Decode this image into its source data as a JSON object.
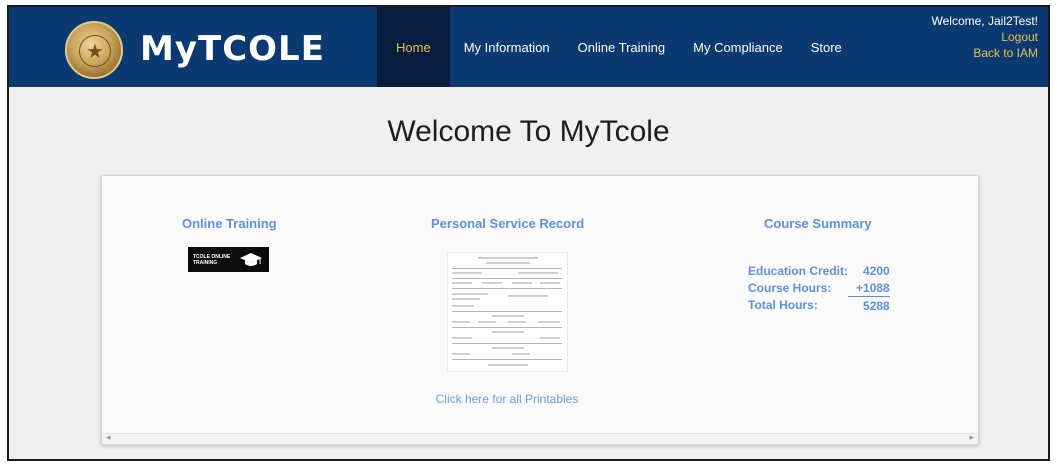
{
  "header": {
    "brand": "MyTCOLE",
    "nav": [
      {
        "label": "Home",
        "active": true
      },
      {
        "label": "My Information"
      },
      {
        "label": "Online Training"
      },
      {
        "label": "My Compliance"
      },
      {
        "label": "Store"
      }
    ],
    "user": {
      "welcome": "Welcome, Jail2Test!",
      "logout": "Logout",
      "back": "Back to IAM"
    }
  },
  "main": {
    "title": "Welcome To MyTcole",
    "online_training": {
      "title": "Online Training",
      "badge_text": "TCOLE ONLINE TRAINING",
      "badge_icon": "graduation-cap-icon"
    },
    "service_record": {
      "title": "Personal Service Record",
      "printables_link": "Click here for all Printables"
    },
    "course_summary": {
      "title": "Course Summary",
      "rows": [
        {
          "label": "Education Credit:",
          "value": "4200"
        },
        {
          "label": "Course Hours:",
          "value": "+1088"
        },
        {
          "label": "Total Hours:",
          "value": "5288"
        }
      ]
    }
  },
  "colors": {
    "header_bg": "#0b3a73",
    "nav_active_bg": "#061d3d",
    "link_gold": "#e8c04a",
    "accent_blue": "#5f8fe6"
  }
}
